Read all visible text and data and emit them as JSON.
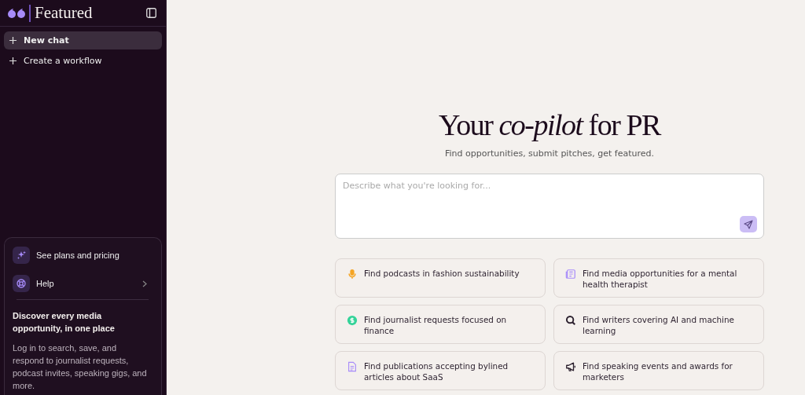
{
  "sidebar": {
    "brand": "Featured",
    "nav": [
      {
        "label": "New chat",
        "selected": true
      },
      {
        "label": "Create a workflow",
        "selected": false
      }
    ],
    "footer": {
      "links": [
        {
          "label": "See plans and pricing",
          "kind": "sparkle",
          "chevron": false
        },
        {
          "label": "Help",
          "kind": "lifebuoy",
          "chevron": true
        }
      ],
      "promo_title": "Discover every media opportunity, in one place",
      "promo_text": "Log in to search, save, and respond to journalist requests, podcast invites, speaking gigs, and more."
    }
  },
  "main": {
    "headline": "Your *co-pilot* for PR",
    "subtitle": "Find opportunities, submit pitches, get featured.",
    "prompt": {
      "placeholder": "Describe what you're looking for..."
    },
    "suggestions": [
      {
        "text": "Find podcasts in fashion sustainability",
        "kind": "microphone",
        "color": "#f5a524"
      },
      {
        "text": "Find media opportunities for a mental health therapist",
        "kind": "newspaper",
        "color": "#a78bfa"
      },
      {
        "text": "Find journalist requests focused on finance",
        "kind": "dollar",
        "color": "#34d399"
      },
      {
        "text": "Find writers covering AI and machine learning",
        "kind": "search",
        "color": "#2a1f2d"
      },
      {
        "text": "Find publications accepting bylined articles about SaaS",
        "kind": "document",
        "color": "#a78bfa"
      },
      {
        "text": "Find speaking events and awards for marketers",
        "kind": "megaphone",
        "color": "#2a1f2d"
      }
    ]
  }
}
